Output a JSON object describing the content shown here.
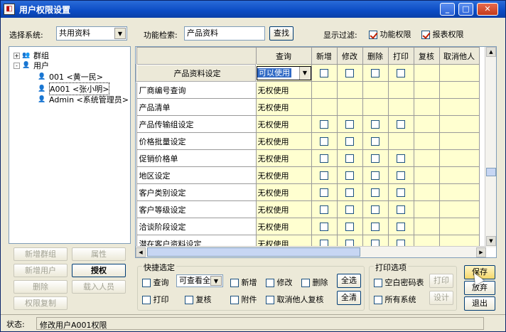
{
  "window": {
    "title": "用户权限设置",
    "min": "_",
    "max": "□",
    "close": "✕"
  },
  "left": {
    "system_label": "选择系统:",
    "system_value": "共用资料",
    "tree": [
      {
        "label": "群组",
        "level": 0,
        "toggle": "+"
      },
      {
        "label": "用户",
        "level": 0,
        "toggle": "-"
      },
      {
        "label": "001 <黄一民>",
        "level": 1
      },
      {
        "label": "A001 <张小明>",
        "level": 1,
        "selected": true
      },
      {
        "label": "Admin <系统管理员>",
        "level": 1
      }
    ],
    "buttons": {
      "add_group": "新增群组",
      "props": "属性",
      "add_user": "新增用户",
      "authorize": "授权",
      "delete": "删除",
      "load_users": "载入人员",
      "copy_perm": "权限复制"
    }
  },
  "search": {
    "label": "功能检索:",
    "value": "产品资料",
    "button": "查找"
  },
  "filter": {
    "label": "显示过滤:",
    "func": "功能权限",
    "report": "报表权限"
  },
  "grid": {
    "columns": [
      "查询",
      "新增",
      "修改",
      "删除",
      "打印",
      "复核",
      "取消他人"
    ],
    "rows": [
      {
        "name": "产品资料设定",
        "query": "可以使用",
        "checks": [
          1,
          1,
          1,
          1,
          0,
          0
        ],
        "header": true
      },
      {
        "name": "厂商编号查询",
        "query": "无权使用",
        "checks": [
          0,
          0,
          0,
          0,
          0,
          0
        ]
      },
      {
        "name": "产品清单",
        "query": "无权使用",
        "checks": [
          0,
          0,
          0,
          0,
          0,
          0
        ]
      },
      {
        "name": "产品传输组设定",
        "query": "无权使用",
        "checks": [
          1,
          1,
          1,
          1,
          0,
          0
        ]
      },
      {
        "name": "价格批量设定",
        "query": "无权使用",
        "checks": [
          1,
          1,
          1,
          0,
          0,
          0
        ]
      },
      {
        "name": "促销价格单",
        "query": "无权使用",
        "checks": [
          1,
          1,
          1,
          1,
          0,
          0
        ]
      },
      {
        "name": "地区设定",
        "query": "无权使用",
        "checks": [
          1,
          1,
          1,
          1,
          0,
          0
        ]
      },
      {
        "name": "客户类别设定",
        "query": "无权使用",
        "checks": [
          1,
          1,
          1,
          1,
          0,
          0
        ]
      },
      {
        "name": "客户等级设定",
        "query": "无权使用",
        "checks": [
          1,
          1,
          1,
          1,
          0,
          0
        ]
      },
      {
        "name": "洽谈阶段设定",
        "query": "无权使用",
        "checks": [
          1,
          1,
          1,
          1,
          0,
          0
        ]
      },
      {
        "name": "潜在客户资料设定",
        "query": "无权使用",
        "checks": [
          1,
          1,
          1,
          1,
          0,
          0
        ]
      }
    ]
  },
  "quick": {
    "title": "快捷选定",
    "query": "查询",
    "combo": "可查看全",
    "add": "新增",
    "edit": "修改",
    "del": "删除",
    "select_all": "全选",
    "print": "打印",
    "review": "复核",
    "attach": "附件",
    "cancel_other": "取消他人复核",
    "clear_all": "全清"
  },
  "print_opts": {
    "title": "打印选项",
    "blank_pwd": "空白密码表",
    "print_btn": "打印",
    "all_sys": "所有系统",
    "design": "设计"
  },
  "actions": {
    "save": "保存",
    "discard": "放弃",
    "exit": "退出"
  },
  "status": {
    "label": "状态:",
    "text": "修改用户A001权限"
  }
}
